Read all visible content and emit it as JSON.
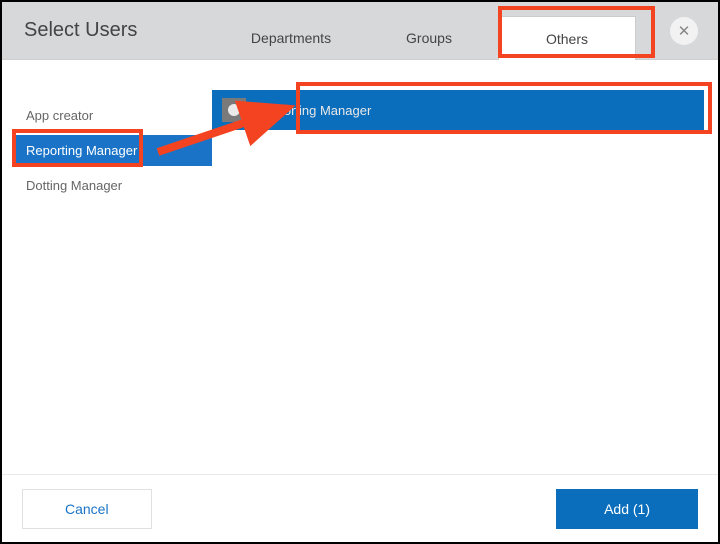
{
  "header": {
    "title": "Select Users"
  },
  "tabs": [
    {
      "label": "Departments",
      "active": false
    },
    {
      "label": "Groups",
      "active": false
    },
    {
      "label": "Others",
      "active": true
    }
  ],
  "sidebar": {
    "items": [
      {
        "label": "App creator",
        "selected": false
      },
      {
        "label": "Reporting Manager",
        "selected": true
      },
      {
        "label": "Dotting Manager",
        "selected": false
      }
    ]
  },
  "main": {
    "rows": [
      {
        "label": "Reporting Manager",
        "checked": true
      }
    ]
  },
  "footer": {
    "cancel_label": "Cancel",
    "add_label": "Add (1)"
  },
  "close_icon": "✕",
  "highlights": {
    "color": "#f44321"
  }
}
